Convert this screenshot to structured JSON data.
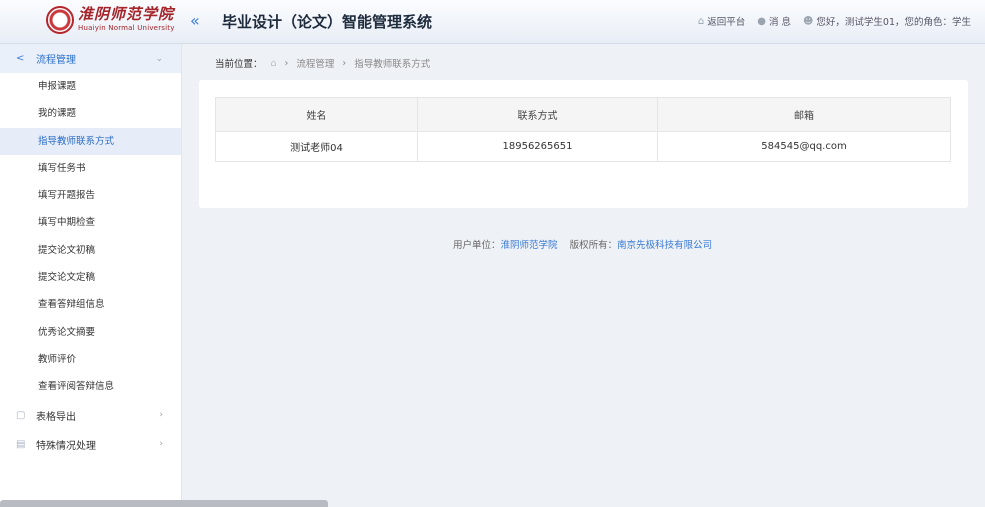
{
  "header": {
    "logo_cn": "淮阴师范学院",
    "logo_en": "Huaiyin Normal University",
    "app_title": "毕业设计（论文）智能管理系统",
    "back_label": "返回平台",
    "msg_label": "消 息",
    "user_label": "您好，测试学生01，您的角色：学生"
  },
  "sidebar": {
    "group1": "流程管理",
    "items": [
      {
        "label": "申报课题"
      },
      {
        "label": "我的课题"
      },
      {
        "label": "指导教师联系方式"
      },
      {
        "label": "填写任务书"
      },
      {
        "label": "填写开题报告"
      },
      {
        "label": "填写中期检查"
      },
      {
        "label": "提交论文初稿"
      },
      {
        "label": "提交论文定稿"
      },
      {
        "label": "查看答辩组信息"
      },
      {
        "label": "优秀论文摘要"
      },
      {
        "label": "教师评价"
      },
      {
        "label": "查看评阅答辩信息"
      }
    ],
    "group2": "表格导出",
    "group3": "特殊情况处理"
  },
  "breadcrumb": {
    "prefix": "当前位置：",
    "level1": "流程管理",
    "level2": "指导教师联系方式"
  },
  "table": {
    "headers": [
      "姓名",
      "联系方式",
      "邮箱"
    ],
    "rows": [
      [
        "测试老师04",
        "18956265651",
        "584545@qq.com"
      ]
    ]
  },
  "footer": {
    "unit_prefix": "用户单位：",
    "unit": "淮阴师范学院",
    "copyright_prefix": "版权所有：",
    "company": "南京先极科技有限公司"
  },
  "colors": {
    "accent": "#2b6fd0",
    "brand": "#a4242a"
  }
}
